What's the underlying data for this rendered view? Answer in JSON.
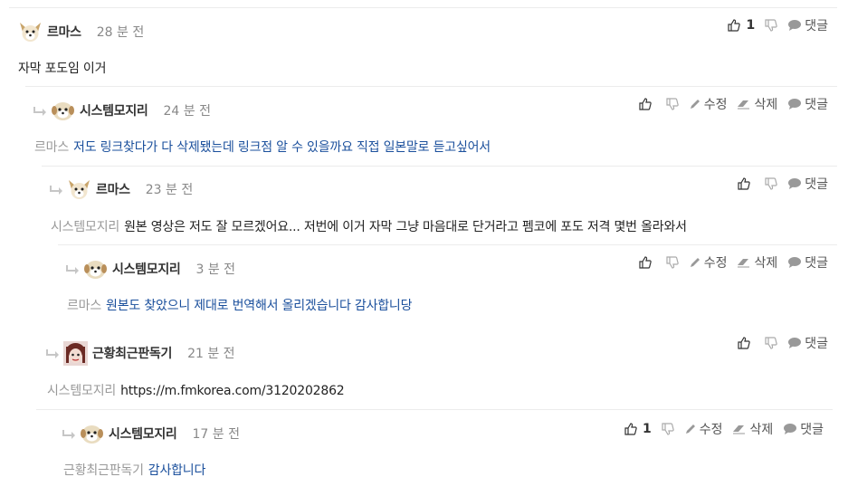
{
  "comments": [
    {
      "author": "르마스",
      "time": "28 분 전",
      "mention": "",
      "text": "자막 포도임 이거",
      "likes": "1",
      "edit_label": "",
      "delete_label": "",
      "reply_label": "댓글"
    },
    {
      "author": "시스템모지리",
      "time": "24 분 전",
      "mention": "르마스",
      "text": "저도 링크찾다가 다 삭제됐는데 링크점 알 수 있을까요 직접 일본말로 듣고싶어서",
      "likes": "",
      "edit_label": "수정",
      "delete_label": "삭제",
      "reply_label": "댓글"
    },
    {
      "author": "르마스",
      "time": "23 분 전",
      "mention": "시스템모지리",
      "text": "원본 영상은 저도 잘 모르겠어요... 저번에 이거 자막 그냥 마음대로 단거라고 펨코에 포도 저격 몇번 올라와서",
      "likes": "",
      "edit_label": "",
      "delete_label": "",
      "reply_label": "댓글"
    },
    {
      "author": "시스템모지리",
      "time": "3 분 전",
      "mention": "르마스",
      "text": "원본도 찾았으니 제대로 번역해서 올리겠습니다 감사합니당",
      "likes": "",
      "edit_label": "수정",
      "delete_label": "삭제",
      "reply_label": "댓글"
    },
    {
      "author": "근황최근판독기",
      "time": "21 분 전",
      "mention": "시스템모지리",
      "text": "https://m.fmkorea.com/3120202862",
      "likes": "",
      "edit_label": "",
      "delete_label": "",
      "reply_label": "댓글"
    },
    {
      "author": "시스템모지리",
      "time": "17 분 전",
      "mention": "근황최근판독기",
      "text": "감사합니다",
      "likes": "1",
      "edit_label": "수정",
      "delete_label": "삭제",
      "reply_label": "댓글"
    }
  ],
  "icons": {
    "like": "thumbs-up-icon",
    "dislike": "thumbs-down-icon",
    "edit": "pencil-icon",
    "delete": "eraser-icon",
    "reply": "speech-bubble-icon",
    "arrow": "reply-arrow-icon"
  },
  "colors": {
    "reply_text": "#1a4f9c",
    "mention": "#999999",
    "border": "#ececec",
    "icon": "#888888"
  }
}
